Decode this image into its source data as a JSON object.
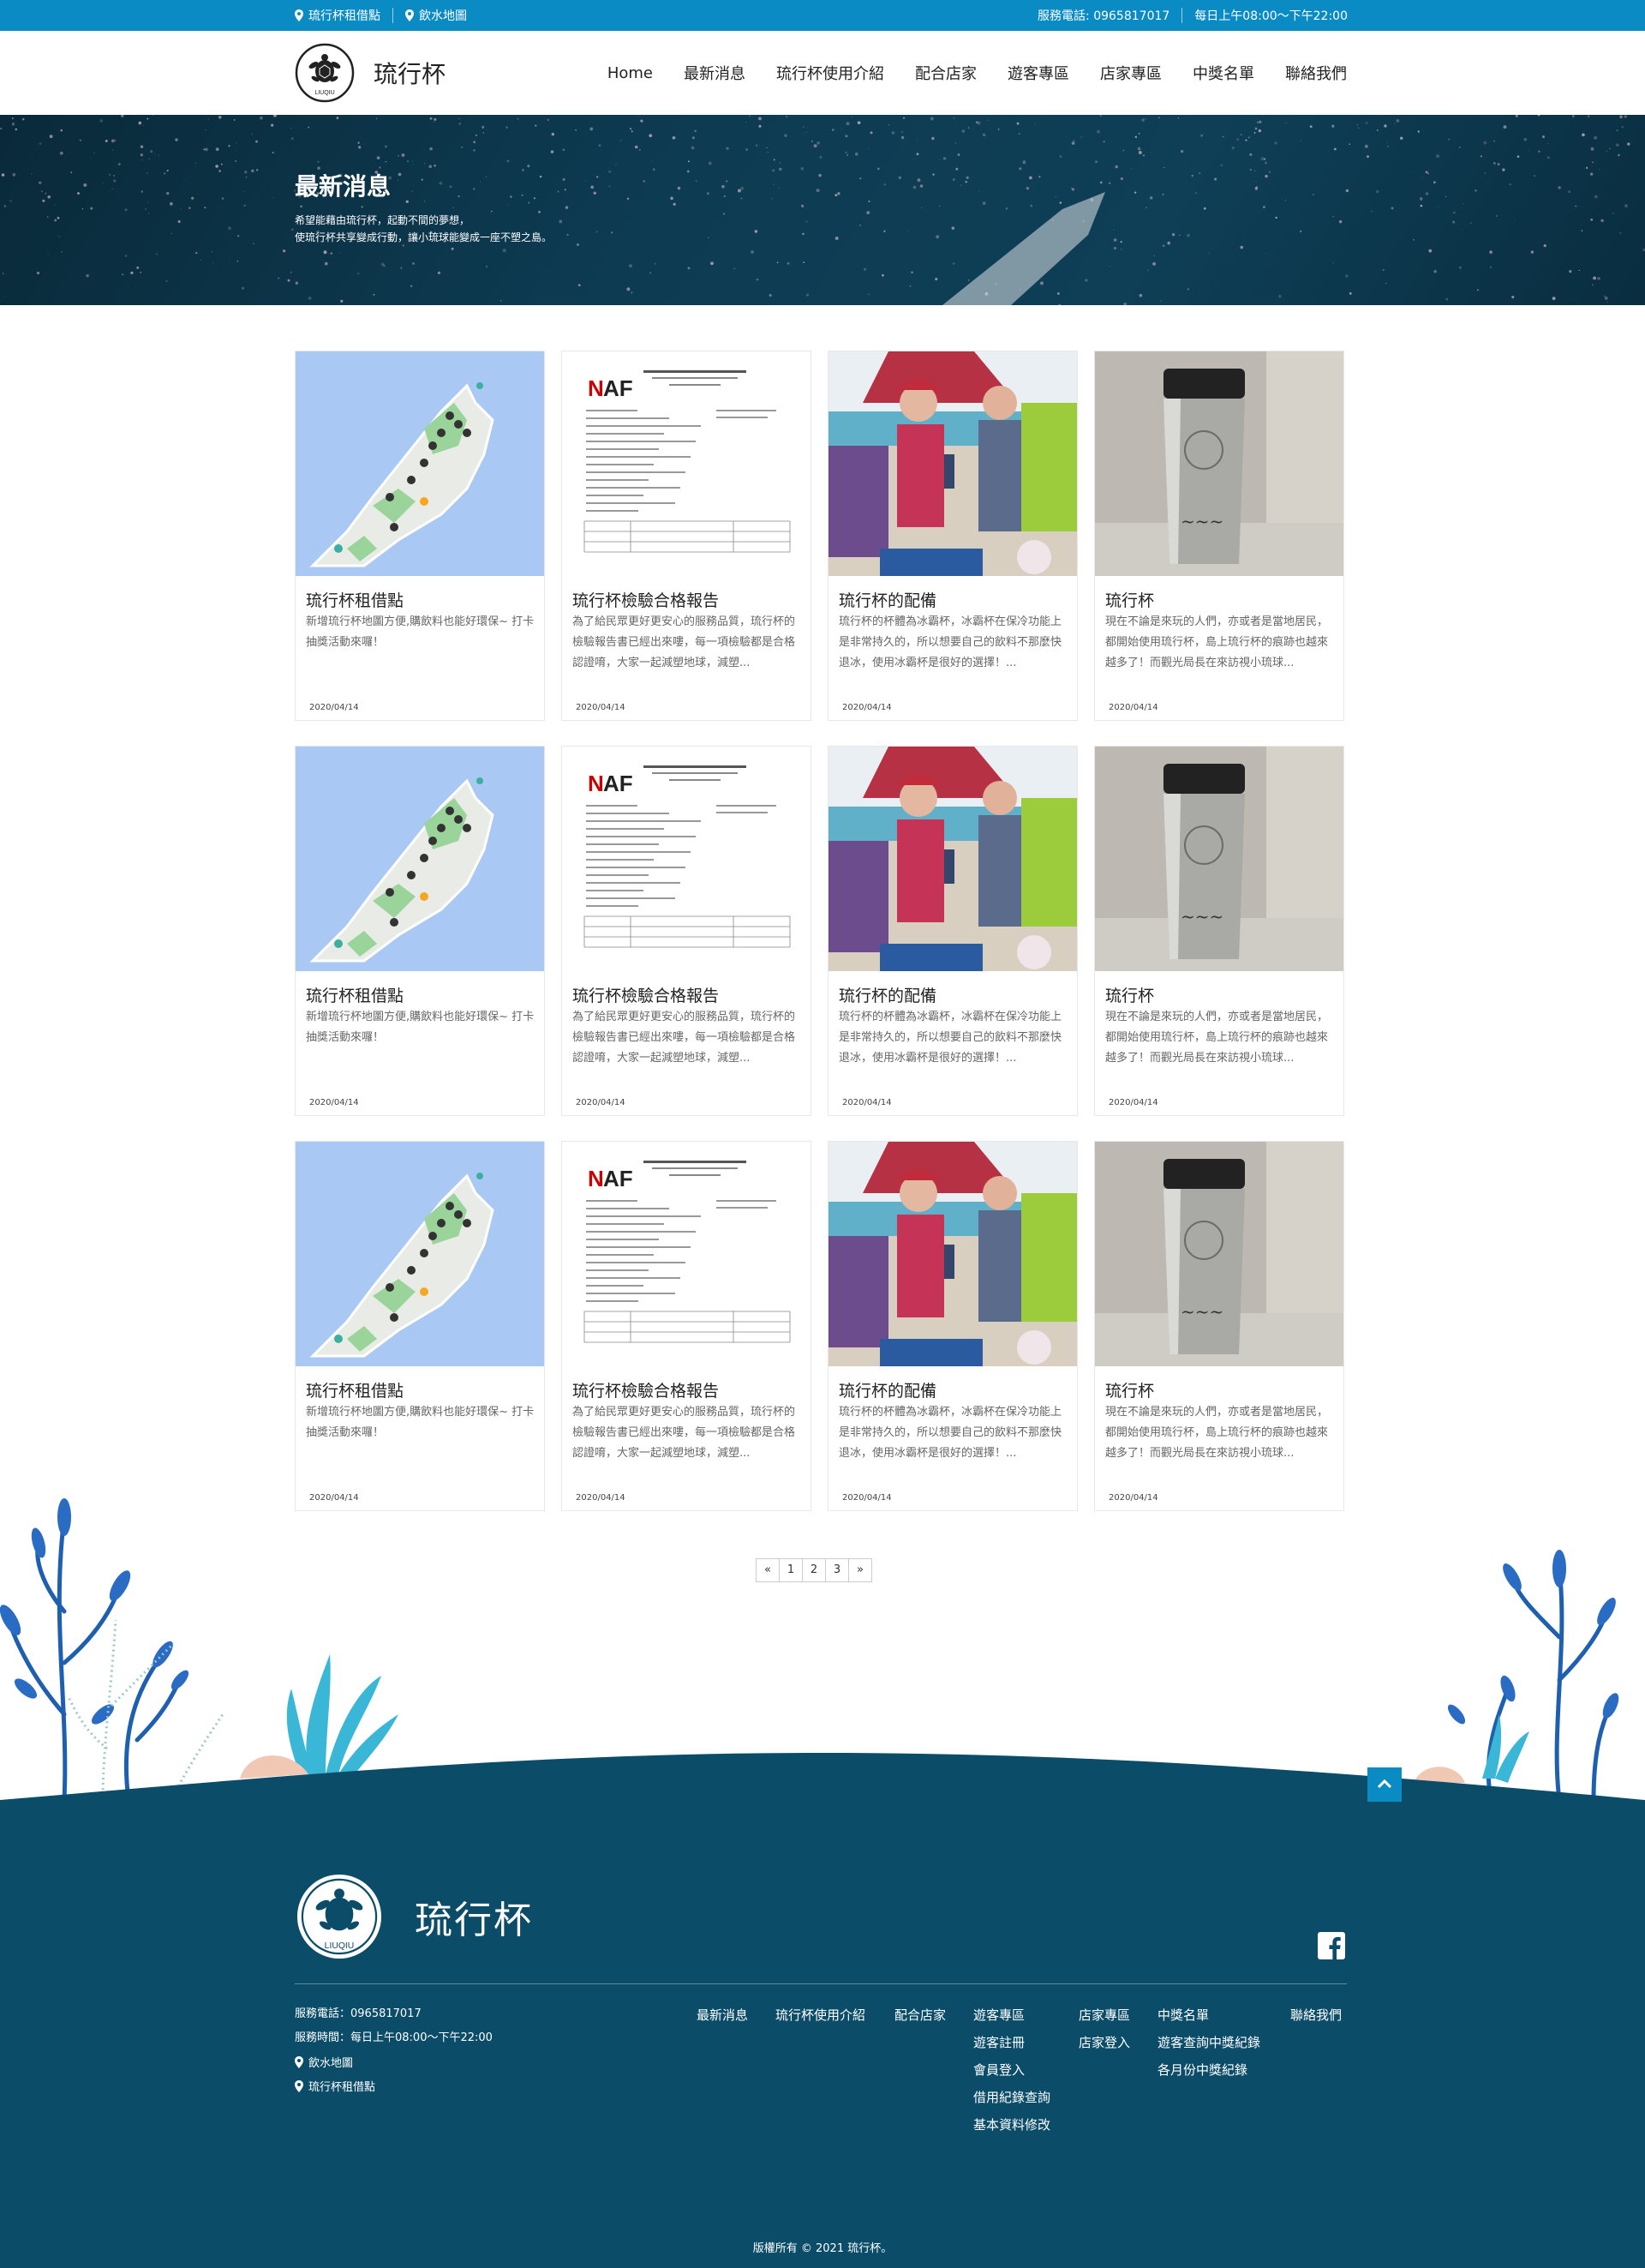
{
  "topbar": {
    "link1": "琉行杯租借點",
    "link2": "飲水地圖",
    "phone": "服務電話: 0965817017",
    "hours": "每日上午08:00～下午22:00"
  },
  "header": {
    "brand": "琉行杯",
    "logo_small_text": "LIUQIU",
    "nav": [
      "Home",
      "最新消息",
      "琉行杯使用介紹",
      "配合店家",
      "遊客專區",
      "店家專區",
      "中獎名單",
      "聯絡我們"
    ]
  },
  "hero": {
    "title": "最新消息",
    "line1": "希望能藉由琉行杯，起動不間的夢想，",
    "line2": "使琉行杯共享變成行動，讓小琉球能變成一座不塑之島。"
  },
  "cards": [
    {
      "title": "琉行杯租借點",
      "desc": "新增琉行杯地圖方便,購飲料也能好環保~ 打卡抽獎活動來囉！",
      "date": "2020/04/14",
      "image": "map"
    },
    {
      "title": "琉行杯檢驗合格報告",
      "desc": "為了給民眾更好更安心的服務品質，琉行杯的檢驗報告書已經出來嘍，每一項檢驗都是合格認證唷，大家一起減塑地球，減塑...",
      "date": "2020/04/14",
      "image": "report"
    },
    {
      "title": "琉行杯的配備",
      "desc": "琉行杯的杯體為冰霸杯，冰霸杯在保冷功能上是非常持久的，所以想要自己的飲料不那麼快退冰，使用冰霸杯是很好的選擇！...",
      "date": "2020/04/14",
      "image": "people"
    },
    {
      "title": "琉行杯",
      "desc": "現在不論是來玩的人們，亦或者是當地居民，都開始使用琉行杯，島上琉行杯的痕跡也越來越多了！而觀光局長在來訪視小琉球...",
      "date": "2020/04/14",
      "image": "cup"
    }
  ],
  "pager": [
    "«",
    "1",
    "2",
    "3",
    "»"
  ],
  "footer": {
    "brand": "琉行杯",
    "phone": "服務電話：0965817017",
    "hours": "服務時間：每日上午08:00～下午22:00",
    "link1": "飲水地圖",
    "link2": "琉行杯租借點",
    "col1": [
      "最新消息"
    ],
    "col2": [
      "琉行杯使用介紹"
    ],
    "col3": [
      "配合店家"
    ],
    "col4": [
      "遊客專區",
      "遊客註冊",
      "會員登入",
      "借用紀錄查詢",
      "基本資料修改"
    ],
    "col5": [
      "店家專區",
      "店家登入"
    ],
    "col6": [
      "中獎名單",
      "遊客查詢中獎紀錄",
      "各月份中獎紀錄"
    ],
    "col7": [
      "聯絡我們"
    ],
    "copyright": "版權所有 © 2021 琉行杯。"
  },
  "colors": {
    "topbar": "#0b8bc3",
    "footer": "#0b4c69",
    "hero": "#0d3b52"
  }
}
